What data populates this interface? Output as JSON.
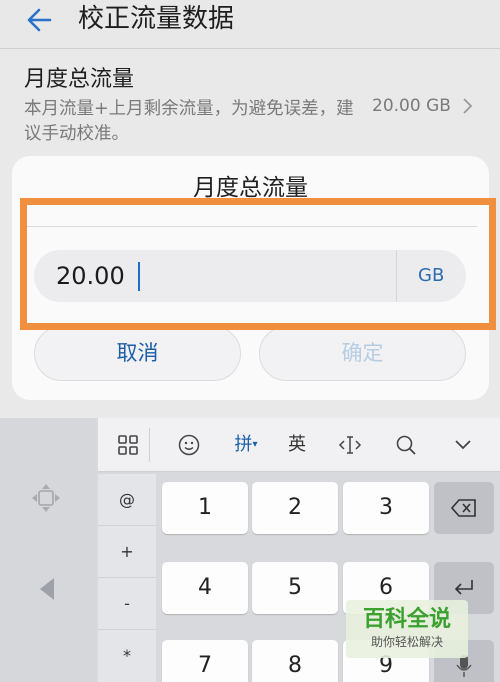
{
  "header": {
    "title": "校正流量数据"
  },
  "setting": {
    "title": "月度总流量",
    "description": "本月流量+上月剩余流量，为避免误差，建议手动校准。",
    "value": "20.00 GB"
  },
  "dialog": {
    "title": "月度总流量",
    "input_value": "20.00",
    "unit": "GB",
    "cancel_label": "取消",
    "confirm_label": "确定"
  },
  "keyboard": {
    "toolbar": {
      "pinyin_label": "拼",
      "english_label": "英"
    },
    "symbols": [
      "@",
      "+",
      "-",
      "*"
    ],
    "digits": [
      "1",
      "2",
      "3",
      "4",
      "5",
      "6",
      "7",
      "8",
      "9"
    ]
  },
  "watermark": {
    "title": "百科全说",
    "subtitle": "助你轻松解决"
  },
  "colors": {
    "accent": "#1b5fa8",
    "highlight": "#f0903f",
    "disabled": "#b6cde3"
  }
}
